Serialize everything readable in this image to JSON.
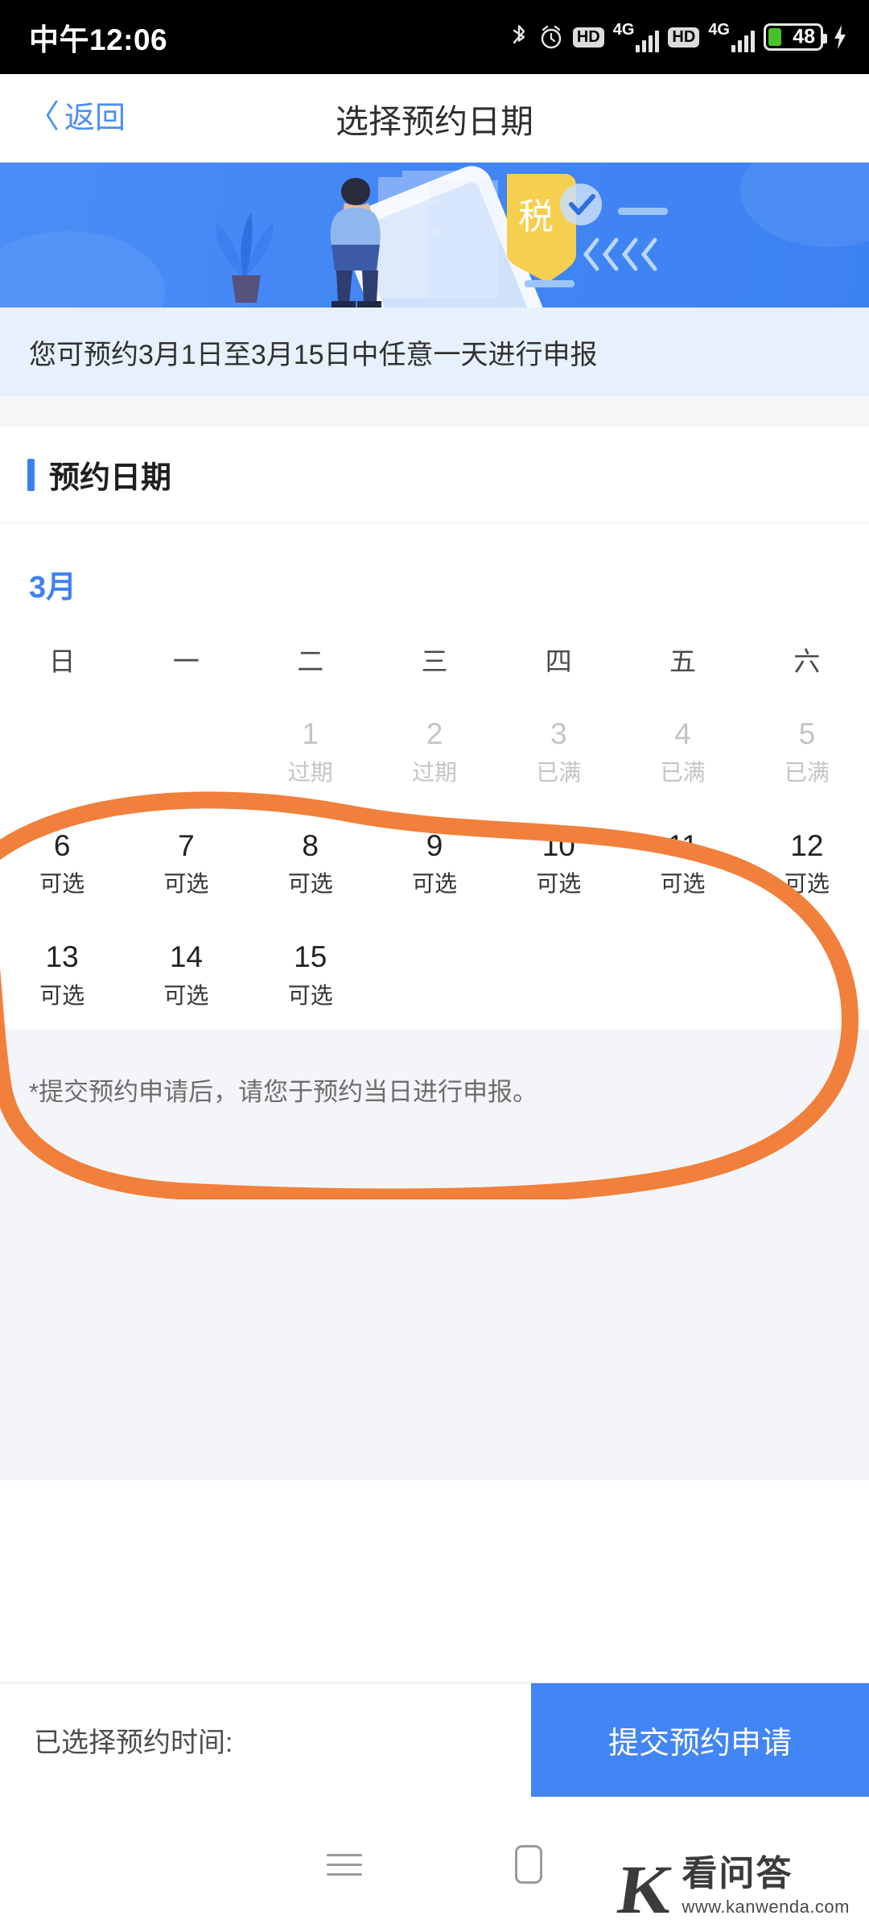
{
  "status_bar": {
    "time": "中午12:06",
    "icons": [
      "bluetooth-icon",
      "alarm-icon",
      "hd-icon",
      "signal-4g-icon",
      "hd-icon",
      "signal-4g-icon",
      "battery-icon",
      "charging-bolt-icon"
    ],
    "hd_label": "HD",
    "network_label": "4G",
    "battery_percent": "48",
    "battery_color": "#49c12a"
  },
  "header": {
    "back_label": "返回",
    "back_chevron": "〈",
    "title": "选择预约日期",
    "back_color": "#4e8ef7"
  },
  "banner": {
    "tag_text": "税",
    "chevrons": "《《《《",
    "bg_color": "#4285f4",
    "tag_color": "#f7cf4f"
  },
  "notice": {
    "text": "您可预约3月1日至3月15日中任意一天进行申报",
    "bg_color": "#e7f1fd"
  },
  "section": {
    "title": "预约日期",
    "accent_color": "#3d7ef0"
  },
  "calendar": {
    "month_label": "3月",
    "month_color": "#3d82f0",
    "weekdays": [
      "日",
      "一",
      "二",
      "三",
      "四",
      "五",
      "六"
    ],
    "states": {
      "expired": "过期",
      "full": "已满",
      "available": "可选"
    },
    "days": [
      {
        "num": "1",
        "state": "过期",
        "disabled": true
      },
      {
        "num": "2",
        "state": "过期",
        "disabled": true
      },
      {
        "num": "3",
        "state": "已满",
        "disabled": true
      },
      {
        "num": "4",
        "state": "已满",
        "disabled": true
      },
      {
        "num": "5",
        "state": "已满",
        "disabled": true
      },
      {
        "num": "6",
        "state": "可选",
        "disabled": false
      },
      {
        "num": "7",
        "state": "可选",
        "disabled": false
      },
      {
        "num": "8",
        "state": "可选",
        "disabled": false
      },
      {
        "num": "9",
        "state": "可选",
        "disabled": false
      },
      {
        "num": "10",
        "state": "可选",
        "disabled": false
      },
      {
        "num": "11",
        "state": "可选",
        "disabled": false
      },
      {
        "num": "12",
        "state": "可选",
        "disabled": false
      },
      {
        "num": "13",
        "state": "可选",
        "disabled": false
      },
      {
        "num": "14",
        "state": "可选",
        "disabled": false
      },
      {
        "num": "15",
        "state": "可选",
        "disabled": false
      }
    ],
    "leading_blanks": 2
  },
  "footnote": {
    "text": "*提交预约申请后，请您于预约当日进行申报。"
  },
  "bottom_bar": {
    "selected_label": "已选择预约时间:",
    "selected_value": "",
    "submit_label": "提交预约申请",
    "submit_color": "#4285f4"
  },
  "nav_bar": {
    "recents": "recents-icon",
    "home": "home-icon"
  },
  "watermark": {
    "logo": "K",
    "title": "看问答",
    "url": "www.kanwenda.com"
  },
  "annotation": {
    "color": "#f0803c",
    "shape": "hand-drawn-ellipse"
  }
}
